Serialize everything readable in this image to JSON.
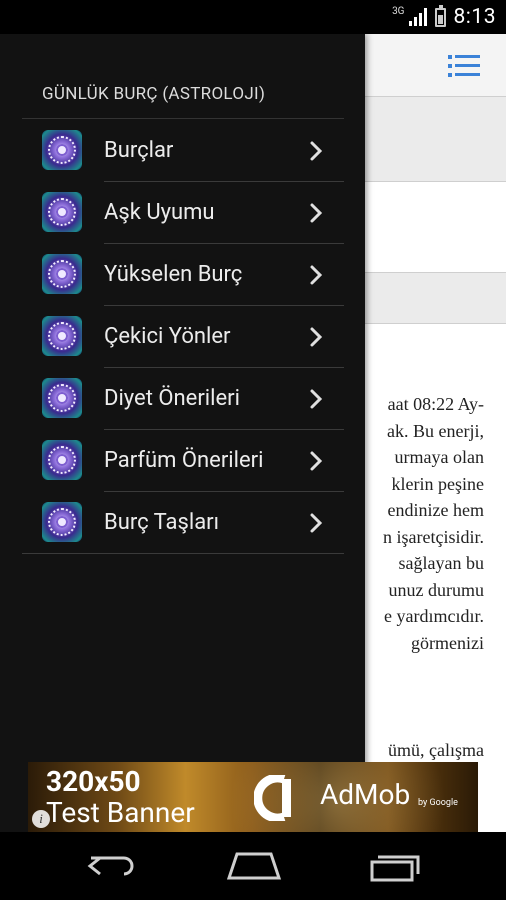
{
  "status_bar": {
    "network": "3G",
    "time": "8:13"
  },
  "drawer": {
    "title": "GÜNLÜK BURÇ (ASTROLOJI)",
    "items": [
      {
        "label": "Burçlar"
      },
      {
        "label": "Aşk Uyumu"
      },
      {
        "label": "Yükselen Burç"
      },
      {
        "label": "Çekici Yönler"
      },
      {
        "label": "Diyet Önerileri"
      },
      {
        "label": "Parfüm Önerileri"
      },
      {
        "label": "Burç Taşları"
      }
    ]
  },
  "content": {
    "lines": [
      "aat 08:22 Ay-",
      "ak. Bu enerji,",
      "urmaya olan",
      "klerin peşine",
      "endinize hem",
      "n işaretçisidir.",
      "sağlayan bu",
      "unuz durumu",
      "e yardımcıdır.",
      "görmenizi"
    ],
    "line_bottom": "ümü, çalışma"
  },
  "ad": {
    "line1": "320x50",
    "line2": "Test Banner",
    "brand": "AdMob",
    "by": "by Google",
    "info": "i"
  },
  "colors": {
    "accent": "#3b82d8",
    "drawer_bg": "#121212"
  }
}
